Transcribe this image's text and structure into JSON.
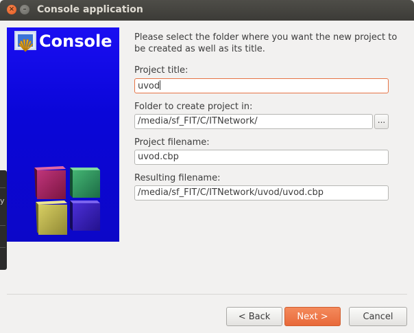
{
  "window": {
    "title": "Console application"
  },
  "banner": {
    "heading": "Console"
  },
  "intro": "Please select the folder where you want the new project to be created as well as its title.",
  "form": {
    "project_title_label": "Project title:",
    "project_title_value": "uvod",
    "folder_label": "Folder to create project in:",
    "folder_value": "/media/sf_FIT/C/ITNetwork/",
    "browse_label": "...",
    "filename_label": "Project filename:",
    "filename_value": "uvod.cbp",
    "resulting_label": "Resulting filename:",
    "resulting_value": "/media/sf_FIT/C/ITNetwork/uvod/uvod.cbp"
  },
  "buttons": {
    "back": "< Back",
    "next": "Next >",
    "cancel": "Cancel"
  },
  "colors": {
    "accent": "#e8693a",
    "banner_blue": "#0c07d8",
    "titlebar": "#3c3b37"
  },
  "icons": {
    "close": "close-icon",
    "minimize": "minimize-icon",
    "logo": "codeblocks-logo-icon"
  }
}
